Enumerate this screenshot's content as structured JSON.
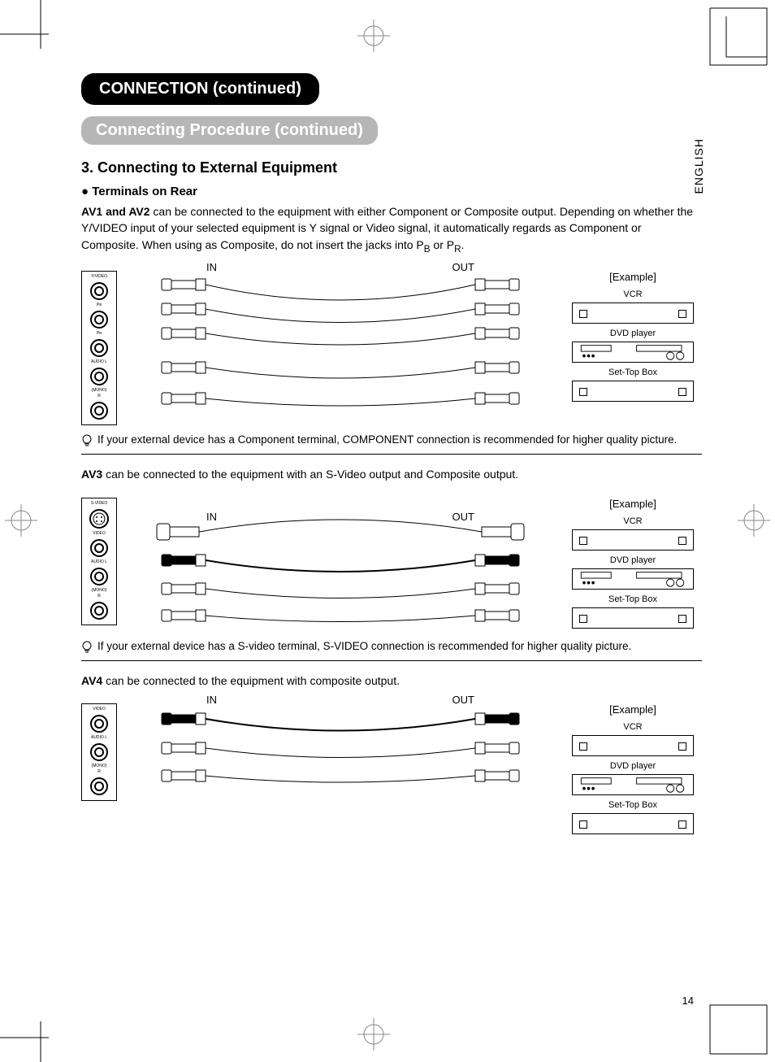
{
  "sidetab": "ENGLISH",
  "h1": "CONNECTION (continued)",
  "h2": "Connecting Procedure (continued)",
  "h3": "3. Connecting to External Equipment",
  "h4": "● Terminals on Rear",
  "av12": {
    "lead": "AV1 and AV2",
    "text": " can be connected to the equipment with either Component or Composite output. Depending on whether the Y/VIDEO input of your selected equipment is Y signal or Video signal, it automatically regards as Component or Composite. When using as Composite, do not insert the jacks into P",
    "sub1": "B",
    "mid": " or P",
    "sub2": "R",
    "tail": "."
  },
  "inLabel": "IN",
  "outLabel": "OUT",
  "exampleLabel": "[Example]",
  "devices": {
    "vcr": "VCR",
    "dvd": "DVD player",
    "stb": "Set-Top Box"
  },
  "terminals": {
    "av12": [
      "Y/VIDEO",
      "Pʙ",
      "Pʀ",
      "AUDIO L",
      "(MONO)",
      "R"
    ],
    "av3": [
      "S-VIDEO",
      "VIDEO",
      "AUDIO L",
      "(MONO)",
      "R"
    ],
    "av4": [
      "VIDEO",
      "AUDIO L",
      "(MONO)",
      "R"
    ]
  },
  "tip1": "If your external device has a Component terminal, COMPONENT connection is recommended for higher quality picture.",
  "av3": {
    "lead": "AV3",
    "text": " can be connected to the equipment with an S-Video output and Composite output."
  },
  "tip2": "If your external device has a S-video terminal, S-VIDEO connection is recommended for higher quality picture.",
  "av4": {
    "lead": "AV4",
    "text": " can be connected to the equipment with composite output."
  },
  "pageNumber": "14"
}
